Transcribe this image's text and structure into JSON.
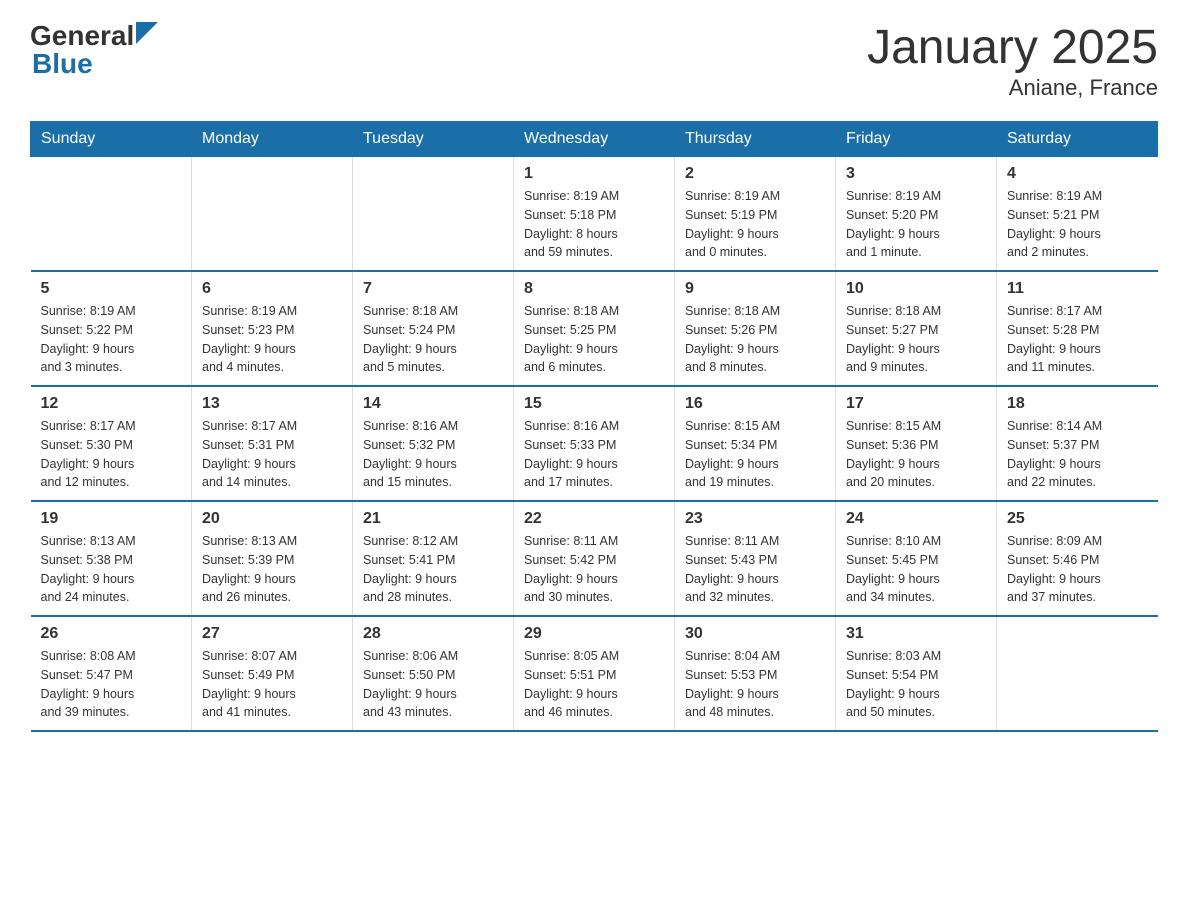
{
  "logo": {
    "text_general": "General",
    "text_blue": "Blue",
    "arrow_desc": "blue triangle arrow"
  },
  "header": {
    "title": "January 2025",
    "subtitle": "Aniane, France"
  },
  "days_of_week": [
    "Sunday",
    "Monday",
    "Tuesday",
    "Wednesday",
    "Thursday",
    "Friday",
    "Saturday"
  ],
  "weeks": [
    [
      {
        "day": "",
        "info": ""
      },
      {
        "day": "",
        "info": ""
      },
      {
        "day": "",
        "info": ""
      },
      {
        "day": "1",
        "info": "Sunrise: 8:19 AM\nSunset: 5:18 PM\nDaylight: 8 hours\nand 59 minutes."
      },
      {
        "day": "2",
        "info": "Sunrise: 8:19 AM\nSunset: 5:19 PM\nDaylight: 9 hours\nand 0 minutes."
      },
      {
        "day": "3",
        "info": "Sunrise: 8:19 AM\nSunset: 5:20 PM\nDaylight: 9 hours\nand 1 minute."
      },
      {
        "day": "4",
        "info": "Sunrise: 8:19 AM\nSunset: 5:21 PM\nDaylight: 9 hours\nand 2 minutes."
      }
    ],
    [
      {
        "day": "5",
        "info": "Sunrise: 8:19 AM\nSunset: 5:22 PM\nDaylight: 9 hours\nand 3 minutes."
      },
      {
        "day": "6",
        "info": "Sunrise: 8:19 AM\nSunset: 5:23 PM\nDaylight: 9 hours\nand 4 minutes."
      },
      {
        "day": "7",
        "info": "Sunrise: 8:18 AM\nSunset: 5:24 PM\nDaylight: 9 hours\nand 5 minutes."
      },
      {
        "day": "8",
        "info": "Sunrise: 8:18 AM\nSunset: 5:25 PM\nDaylight: 9 hours\nand 6 minutes."
      },
      {
        "day": "9",
        "info": "Sunrise: 8:18 AM\nSunset: 5:26 PM\nDaylight: 9 hours\nand 8 minutes."
      },
      {
        "day": "10",
        "info": "Sunrise: 8:18 AM\nSunset: 5:27 PM\nDaylight: 9 hours\nand 9 minutes."
      },
      {
        "day": "11",
        "info": "Sunrise: 8:17 AM\nSunset: 5:28 PM\nDaylight: 9 hours\nand 11 minutes."
      }
    ],
    [
      {
        "day": "12",
        "info": "Sunrise: 8:17 AM\nSunset: 5:30 PM\nDaylight: 9 hours\nand 12 minutes."
      },
      {
        "day": "13",
        "info": "Sunrise: 8:17 AM\nSunset: 5:31 PM\nDaylight: 9 hours\nand 14 minutes."
      },
      {
        "day": "14",
        "info": "Sunrise: 8:16 AM\nSunset: 5:32 PM\nDaylight: 9 hours\nand 15 minutes."
      },
      {
        "day": "15",
        "info": "Sunrise: 8:16 AM\nSunset: 5:33 PM\nDaylight: 9 hours\nand 17 minutes."
      },
      {
        "day": "16",
        "info": "Sunrise: 8:15 AM\nSunset: 5:34 PM\nDaylight: 9 hours\nand 19 minutes."
      },
      {
        "day": "17",
        "info": "Sunrise: 8:15 AM\nSunset: 5:36 PM\nDaylight: 9 hours\nand 20 minutes."
      },
      {
        "day": "18",
        "info": "Sunrise: 8:14 AM\nSunset: 5:37 PM\nDaylight: 9 hours\nand 22 minutes."
      }
    ],
    [
      {
        "day": "19",
        "info": "Sunrise: 8:13 AM\nSunset: 5:38 PM\nDaylight: 9 hours\nand 24 minutes."
      },
      {
        "day": "20",
        "info": "Sunrise: 8:13 AM\nSunset: 5:39 PM\nDaylight: 9 hours\nand 26 minutes."
      },
      {
        "day": "21",
        "info": "Sunrise: 8:12 AM\nSunset: 5:41 PM\nDaylight: 9 hours\nand 28 minutes."
      },
      {
        "day": "22",
        "info": "Sunrise: 8:11 AM\nSunset: 5:42 PM\nDaylight: 9 hours\nand 30 minutes."
      },
      {
        "day": "23",
        "info": "Sunrise: 8:11 AM\nSunset: 5:43 PM\nDaylight: 9 hours\nand 32 minutes."
      },
      {
        "day": "24",
        "info": "Sunrise: 8:10 AM\nSunset: 5:45 PM\nDaylight: 9 hours\nand 34 minutes."
      },
      {
        "day": "25",
        "info": "Sunrise: 8:09 AM\nSunset: 5:46 PM\nDaylight: 9 hours\nand 37 minutes."
      }
    ],
    [
      {
        "day": "26",
        "info": "Sunrise: 8:08 AM\nSunset: 5:47 PM\nDaylight: 9 hours\nand 39 minutes."
      },
      {
        "day": "27",
        "info": "Sunrise: 8:07 AM\nSunset: 5:49 PM\nDaylight: 9 hours\nand 41 minutes."
      },
      {
        "day": "28",
        "info": "Sunrise: 8:06 AM\nSunset: 5:50 PM\nDaylight: 9 hours\nand 43 minutes."
      },
      {
        "day": "29",
        "info": "Sunrise: 8:05 AM\nSunset: 5:51 PM\nDaylight: 9 hours\nand 46 minutes."
      },
      {
        "day": "30",
        "info": "Sunrise: 8:04 AM\nSunset: 5:53 PM\nDaylight: 9 hours\nand 48 minutes."
      },
      {
        "day": "31",
        "info": "Sunrise: 8:03 AM\nSunset: 5:54 PM\nDaylight: 9 hours\nand 50 minutes."
      },
      {
        "day": "",
        "info": ""
      }
    ]
  ]
}
